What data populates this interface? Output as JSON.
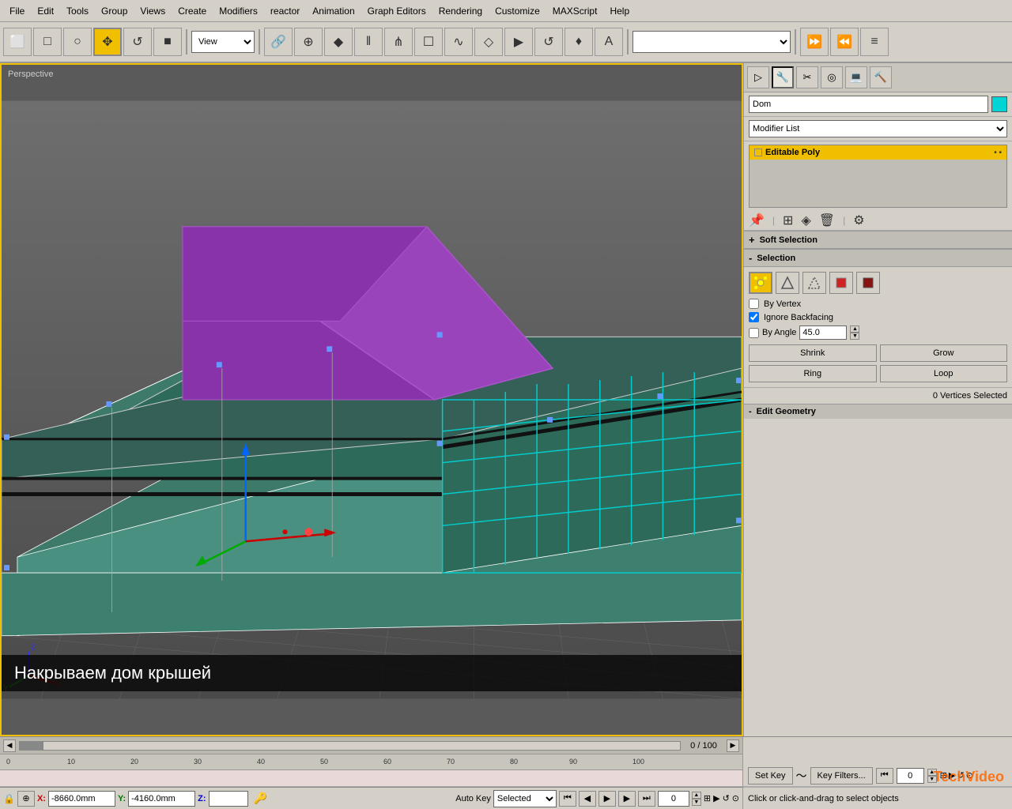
{
  "menubar": {
    "items": [
      "File",
      "Edit",
      "Tools",
      "Group",
      "Views",
      "Create",
      "Modifiers",
      "reactor",
      "Animation",
      "Graph Editors",
      "Rendering",
      "Customize",
      "MAXScript",
      "Help"
    ]
  },
  "toolbar": {
    "dropdown_view": "View"
  },
  "viewport": {
    "label": "Perspective"
  },
  "subtitle": {
    "text": "Накрываем дом крышей"
  },
  "right_panel": {
    "obj_name": "Dom",
    "modifier_list_label": "Modifier List",
    "stack_items": [
      {
        "name": "Editable Poly",
        "active": true
      }
    ],
    "soft_selection_label": "Soft Selection",
    "selection_label": "Selection",
    "by_vertex_label": "By Vertex",
    "ignore_backfacing_label": "Ignore Backfacing",
    "by_angle_label": "By Angle",
    "by_angle_value": "45.0",
    "shrink_label": "Shrink",
    "grow_label": "Grow",
    "vertices_selected": "0 Vertices Selected",
    "edit_geometry_label": "Edit Geometry"
  },
  "timeline": {
    "position": "0 / 100",
    "markers": [
      "0",
      "10",
      "20",
      "30",
      "40",
      "50",
      "60",
      "70",
      "80",
      "90",
      "100"
    ]
  },
  "statusbar": {
    "text": "Click or click-and-drag to select objects",
    "x_label": "X:",
    "x_value": "-8660.0mm",
    "y_label": "Y:",
    "y_value": "-4160.0mm",
    "z_label": "Z:",
    "autokey_label": "Auto Key",
    "selected_label": "Selected",
    "setkey_label": "Set Key",
    "key_filters_label": "Key Filters...",
    "frame_value": "0"
  }
}
